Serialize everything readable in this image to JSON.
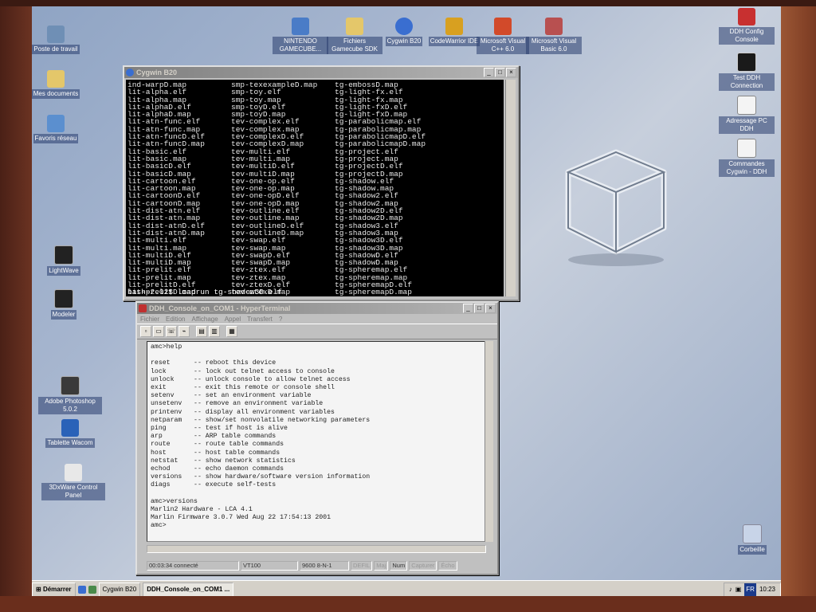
{
  "desktop_icons_left": [
    {
      "label": "Poste de travail",
      "color": "#6f8fb5"
    },
    {
      "label": "Mes documents",
      "color": "#e4c76a"
    },
    {
      "label": "Favoris réseau",
      "color": "#5b8fcf"
    },
    {
      "label": "LightWave",
      "color": "#222222"
    },
    {
      "label": "Modeler",
      "color": "#222222"
    },
    {
      "label": "Adobe Photoshop 5.0.2",
      "color": "#3a3a3a"
    },
    {
      "label": "Tablette Wacom",
      "color": "#2a62b8"
    },
    {
      "label": "3DxWare Control Panel",
      "color": "#e8e8e8"
    }
  ],
  "desktop_icons_top": [
    {
      "label": "NINTENDO GAMECUBE...",
      "color": "#4a7cc7"
    },
    {
      "label": "Fichiers Gamecube SDK",
      "color": "#e4c76a"
    },
    {
      "label": "Cygwin B20",
      "color": "#3a6ed0"
    },
    {
      "label": "CodeWarrior IDE",
      "color": "#d8a020"
    },
    {
      "label": "Microsoft Visual C++ 6.0",
      "color": "#d24a2a"
    },
    {
      "label": "Microsoft Visual Basic 6.0",
      "color": "#b85050"
    }
  ],
  "desktop_icons_right": [
    {
      "label": "DDH Config Console",
      "color": "#c83030"
    },
    {
      "label": "Test DDH Connection",
      "color": "#1a1a1a"
    },
    {
      "label": "Adressage PC DDH",
      "color": "#f4f4f4"
    },
    {
      "label": "Commandes Cygwin - DDH",
      "color": "#f4f4f4"
    },
    {
      "label": "Corbeille",
      "color": "#c8d4e8"
    }
  ],
  "cygwin": {
    "title": "Cygwin B20",
    "col1": [
      "ind-warpD.map",
      "lit-alpha.elf",
      "lit-alpha.map",
      "lit-alphaD.elf",
      "lit-alphaD.map",
      "lit-atn-func.elf",
      "lit-atn-func.map",
      "lit-atn-funcD.elf",
      "lit-atn-funcD.map",
      "lit-basic.elf",
      "lit-basic.map",
      "lit-basicD.elf",
      "lit-basicD.map",
      "lit-cartoon.elf",
      "lit-cartoon.map",
      "lit-cartoonD.elf",
      "lit-cartoonD.map",
      "lit-dist-atn.elf",
      "lit-dist-atn.map",
      "lit-dist-atnD.elf",
      "lit-dist-atnD.map",
      "lit-multi.elf",
      "lit-multi.map",
      "lit-multiD.elf",
      "lit-multiD.map",
      "lit-prelit.elf",
      "lit-prelit.map",
      "lit-prelitD.elf",
      "lit-prelitD.map"
    ],
    "col2": [
      "smp-texexampleD.map",
      "smp-toy.elf",
      "smp-toy.map",
      "smp-toyD.elf",
      "smp-toyD.map",
      "tev-complex.elf",
      "tev-complex.map",
      "tev-complexD.elf",
      "tev-complexD.map",
      "tev-multi.elf",
      "tev-multi.map",
      "tev-multiD.elf",
      "tev-multiD.map",
      "tev-one-op.elf",
      "tev-one-op.map",
      "tev-one-opD.elf",
      "tev-one-opD.map",
      "tev-outline.elf",
      "tev-outline.map",
      "tev-outlineD.elf",
      "tev-outlineD.map",
      "tev-swap.elf",
      "tev-swap.map",
      "tev-swapD.elf",
      "tev-swapD.map",
      "tev-ztex.elf",
      "tev-ztex.map",
      "tev-ztexD.elf",
      "tev-ztexD.map"
    ],
    "col3": [
      "tg-embossD.map",
      "tg-light-fx.elf",
      "tg-light-fx.map",
      "tg-light-fxD.elf",
      "tg-light-fxD.map",
      "tg-parabolicmap.elf",
      "tg-parabolicmap.map",
      "tg-parabolicmapD.elf",
      "tg-parabolicmapD.map",
      "tg-project.elf",
      "tg-project.map",
      "tg-projectD.elf",
      "tg-projectD.map",
      "tg-shadow.elf",
      "tg-shadow.map",
      "tg-shadow2.elf",
      "tg-shadow2.map",
      "tg-shadow2D.elf",
      "tg-shadow2D.map",
      "tg-shadow3.elf",
      "tg-shadow3.map",
      "tg-shadow3D.elf",
      "tg-shadow3D.map",
      "tg-shadowD.elf",
      "tg-shadowD.map",
      "tg-spheremap.elf",
      "tg-spheremap.map",
      "tg-spheremapD.elf",
      "tg-spheremapD.map"
    ],
    "prompt": "bash-2.02$ loadrun tg-shadow3D.elf"
  },
  "hyper": {
    "title": "DDH_Console_on_COM1 - HyperTerminal",
    "menu": [
      "Fichier",
      "Edition",
      "Affichage",
      "Appel",
      "Transfert",
      "?"
    ],
    "lines": [
      "amc>help",
      "",
      "reset      -- reboot this device",
      "lock       -- lock out telnet access to console",
      "unlock     -- unlock console to allow telnet access",
      "exit       -- exit this remote or console shell",
      "setenv     -- set an environment variable",
      "unsetenv   -- remove an environment variable",
      "printenv   -- display all environment variables",
      "netparam   -- show/set nonvolatile networking parameters",
      "ping       -- test if host is alive",
      "arp        -- ARP table commands",
      "route      -- route table commands",
      "host       -- host table commands",
      "netstat    -- show network statistics",
      "echod      -- echo daemon commands",
      "versions   -- show hardware/software version information",
      "diags      -- execute self-tests",
      "",
      "amc>versions",
      "Marlin2 Hardware - LCA 4.1",
      "Marlin Firmware 3.0.7 Wed Aug 22 17:54:13 2001",
      "amc>"
    ],
    "status": [
      "00:03:34 connecté",
      "VT100",
      "9600 8-N-1",
      "DEFIL",
      "Maj",
      "Num",
      "Capturer",
      "Écho"
    ]
  },
  "taskbar": {
    "start": "Démarrer",
    "tasks": [
      "Cygwin B20",
      "DDH_Console_on_COM1 ..."
    ],
    "clock": "10:23",
    "lang": "FR"
  }
}
